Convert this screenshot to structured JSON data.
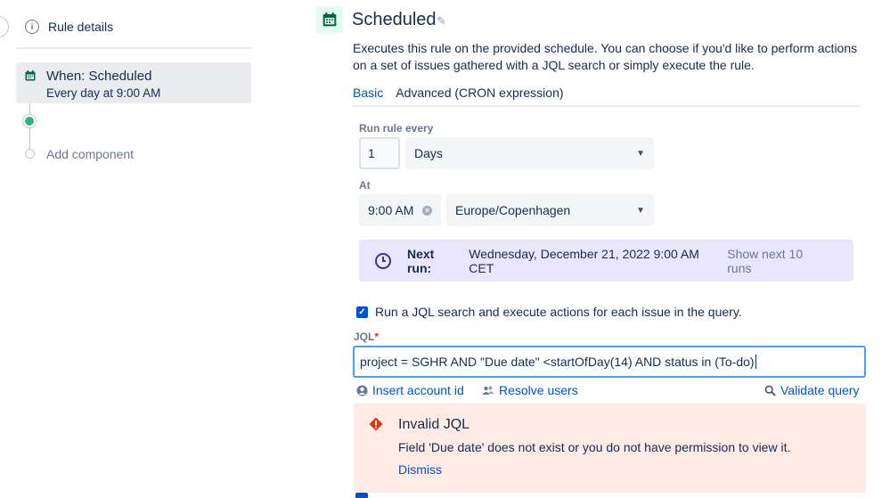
{
  "sidebar": {
    "rule_details": "Rule details",
    "trigger_title": "When: Scheduled",
    "trigger_subtitle": "Every day at 9:00 AM",
    "add_component": "Add component"
  },
  "header": {
    "title": "Scheduled",
    "description": "Executes this rule on the provided schedule. You can choose if you'd like to perform actions on a set of issues gathered with a JQL search or simply execute the rule."
  },
  "tabs": [
    {
      "label": "Basic",
      "active": true
    },
    {
      "label": "Advanced (CRON expression)",
      "active": false
    }
  ],
  "schedule": {
    "run_every_label": "Run rule every",
    "interval_value": "1",
    "interval_unit": "Days",
    "at_label": "At",
    "time_value": "9:00 AM",
    "timezone": "Europe/Copenhagen"
  },
  "next_run": {
    "label": "Next run:",
    "value": "Wednesday, December 21, 2022 9:00 AM CET",
    "show_more": "Show next 10 runs"
  },
  "jql": {
    "checkbox_label": "Run a JQL search and execute actions for each issue in the query.",
    "checked": true,
    "field_label": "JQL",
    "required_mark": "*",
    "query": "project = SGHR AND \"Due date\" <startOfDay(14) AND status in (To-do)",
    "insert_account": "Insert account id",
    "resolve_users": "Resolve users",
    "validate": "Validate query"
  },
  "error": {
    "title": "Invalid JQL",
    "message": "Field 'Due date' does not exist or you do not have permission to view it.",
    "dismiss": "Dismiss"
  },
  "colors": {
    "accent": "#0052cc",
    "success": "#36b37e",
    "error_bg": "#ffebe6",
    "info_bg": "#eae6ff"
  }
}
